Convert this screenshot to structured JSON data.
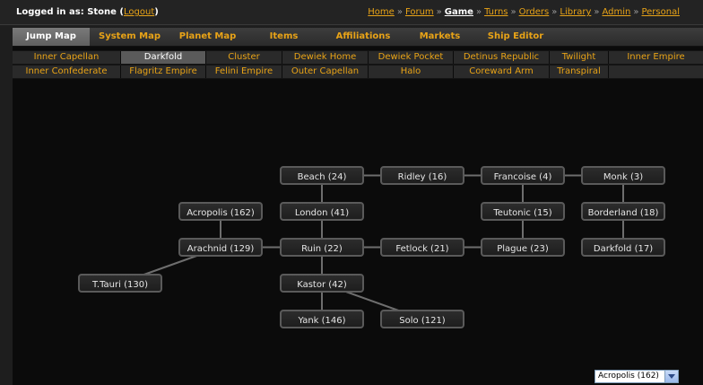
{
  "header": {
    "login_prefix": "Logged in as: Stone (",
    "logout_label": "Logout",
    "login_suffix": ")",
    "links": [
      "Home",
      "Forum",
      "Game",
      "Turns",
      "Orders",
      "Library",
      "Admin",
      "Personal"
    ],
    "active_link": "Game",
    "separator": "»"
  },
  "main_tabs": [
    "Jump Map",
    "System Map",
    "Planet Map",
    "Items",
    "Affiliations",
    "Markets",
    "Ship Editor"
  ],
  "active_main_tab": "Jump Map",
  "regions_row1": [
    "Inner Capellan",
    "Darkfold",
    "Cluster",
    "Dewiek Home",
    "Dewiek Pocket",
    "Detinus Republic",
    "Twilight",
    "Inner Empire"
  ],
  "regions_row2": [
    "Inner Confederate",
    "Flagritz Empire",
    "Felini Empire",
    "Outer Capellan",
    "Halo",
    "Coreward Arm",
    "Transpiral"
  ],
  "active_region": "Darkfold",
  "map": {
    "nodes": [
      {
        "id": "beach",
        "label": "Beach (24)"
      },
      {
        "id": "ridley",
        "label": "Ridley (16)"
      },
      {
        "id": "francoise",
        "label": "Francoise (4)"
      },
      {
        "id": "monk",
        "label": "Monk (3)"
      },
      {
        "id": "acropolis",
        "label": "Acropolis (162)"
      },
      {
        "id": "london",
        "label": "London (41)"
      },
      {
        "id": "teutonic",
        "label": "Teutonic (15)"
      },
      {
        "id": "borderland",
        "label": "Borderland (18)"
      },
      {
        "id": "arachnid",
        "label": "Arachnid (129)"
      },
      {
        "id": "ruin",
        "label": "Ruin (22)"
      },
      {
        "id": "fetlock",
        "label": "Fetlock (21)"
      },
      {
        "id": "plague",
        "label": "Plague (23)"
      },
      {
        "id": "darkfold",
        "label": "Darkfold (17)"
      },
      {
        "id": "ttauri",
        "label": "T.Tauri (130)"
      },
      {
        "id": "kastor",
        "label": "Kastor (42)"
      },
      {
        "id": "yank",
        "label": "Yank (146)"
      },
      {
        "id": "solo",
        "label": "Solo (121)"
      }
    ],
    "links": [
      [
        "beach",
        "ridley"
      ],
      [
        "ridley",
        "francoise"
      ],
      [
        "francoise",
        "monk"
      ],
      [
        "beach",
        "london"
      ],
      [
        "london",
        "ruin"
      ],
      [
        "francoise",
        "teutonic"
      ],
      [
        "teutonic",
        "plague"
      ],
      [
        "monk",
        "borderland"
      ],
      [
        "borderland",
        "darkfold"
      ],
      [
        "acropolis",
        "arachnid"
      ],
      [
        "arachnid",
        "ruin"
      ],
      [
        "ruin",
        "fetlock"
      ],
      [
        "fetlock",
        "plague"
      ],
      [
        "arachnid",
        "ttauri"
      ],
      [
        "ruin",
        "kastor"
      ],
      [
        "kastor",
        "yank"
      ],
      [
        "kastor",
        "solo"
      ]
    ]
  },
  "system_select": {
    "value": "Acropolis (162)"
  }
}
